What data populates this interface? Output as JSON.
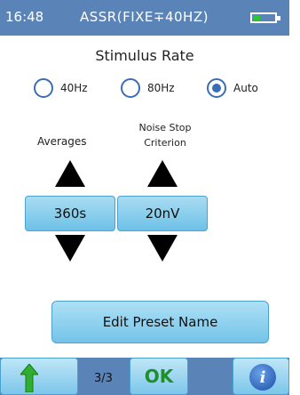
{
  "status_bar": {
    "time": "16:48",
    "mode": "ASSR(FIXE∓40HZ)",
    "battery_level": 0.35,
    "battery_color": "#2ec62e",
    "bg_color": "#5a84b8"
  },
  "stimulus_rate": {
    "title": "Stimulus Rate",
    "options": [
      {
        "label": "40Hz",
        "selected": false
      },
      {
        "label": "80Hz",
        "selected": false
      },
      {
        "label": "Auto",
        "selected": true
      }
    ]
  },
  "averages": {
    "label": "Averages",
    "value": "360s",
    "up_icon": "arrow-up-icon",
    "down_icon": "arrow-down-icon"
  },
  "noise_stop": {
    "label_line1": "Noise Stop",
    "label_line2": "Criterion",
    "value": "20nV",
    "up_icon": "arrow-up-icon",
    "down_icon": "arrow-down-icon"
  },
  "edit_button": {
    "label": "Edit Preset Name"
  },
  "bottom_bar": {
    "page_indicator": "3/3",
    "ok_label": "OK",
    "info_label": "i",
    "back_icon": "green-up-arrow-icon",
    "info_icon": "info-icon"
  },
  "colors": {
    "accent": "#3b6db5",
    "button_light": "#a9dcf2",
    "button_dark": "#6ec1e8",
    "ok_green": "#1f8f2a"
  }
}
